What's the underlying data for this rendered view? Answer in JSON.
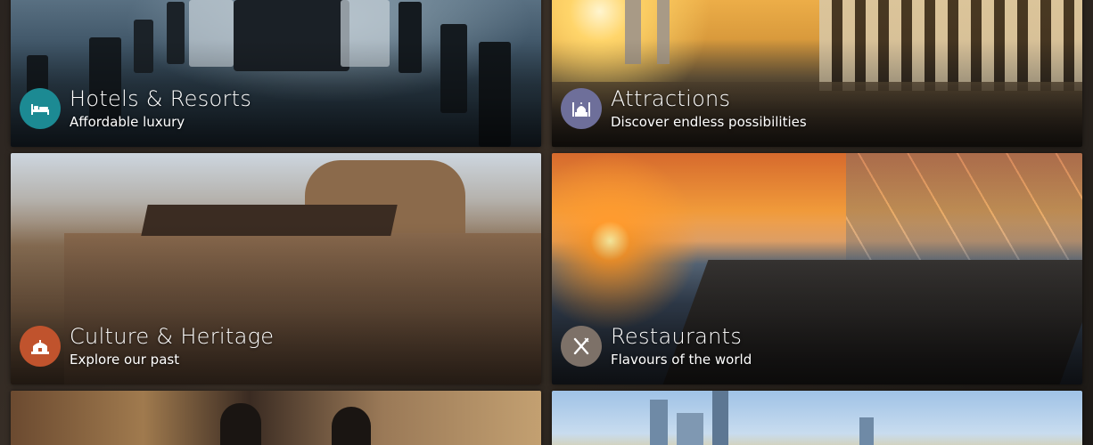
{
  "tiles": [
    {
      "title": "Hotels & Resorts",
      "subtitle": "Affordable luxury",
      "icon": "bed-icon",
      "badge_color": "#1c8a93"
    },
    {
      "title": "Attractions",
      "subtitle": "Discover endless possibilities",
      "icon": "mosque-icon",
      "badge_color": "#6e6f9a"
    },
    {
      "title": "Culture & Heritage",
      "subtitle": "Explore our past",
      "icon": "fort-icon",
      "badge_color": "#c0532d"
    },
    {
      "title": "Restaurants",
      "subtitle": "Flavours of the world",
      "icon": "fork-knife-icon",
      "badge_color": "#7d7168"
    },
    {
      "title": "",
      "subtitle": "",
      "icon": "",
      "badge_color": ""
    },
    {
      "title": "",
      "subtitle": "",
      "icon": "",
      "badge_color": ""
    }
  ]
}
